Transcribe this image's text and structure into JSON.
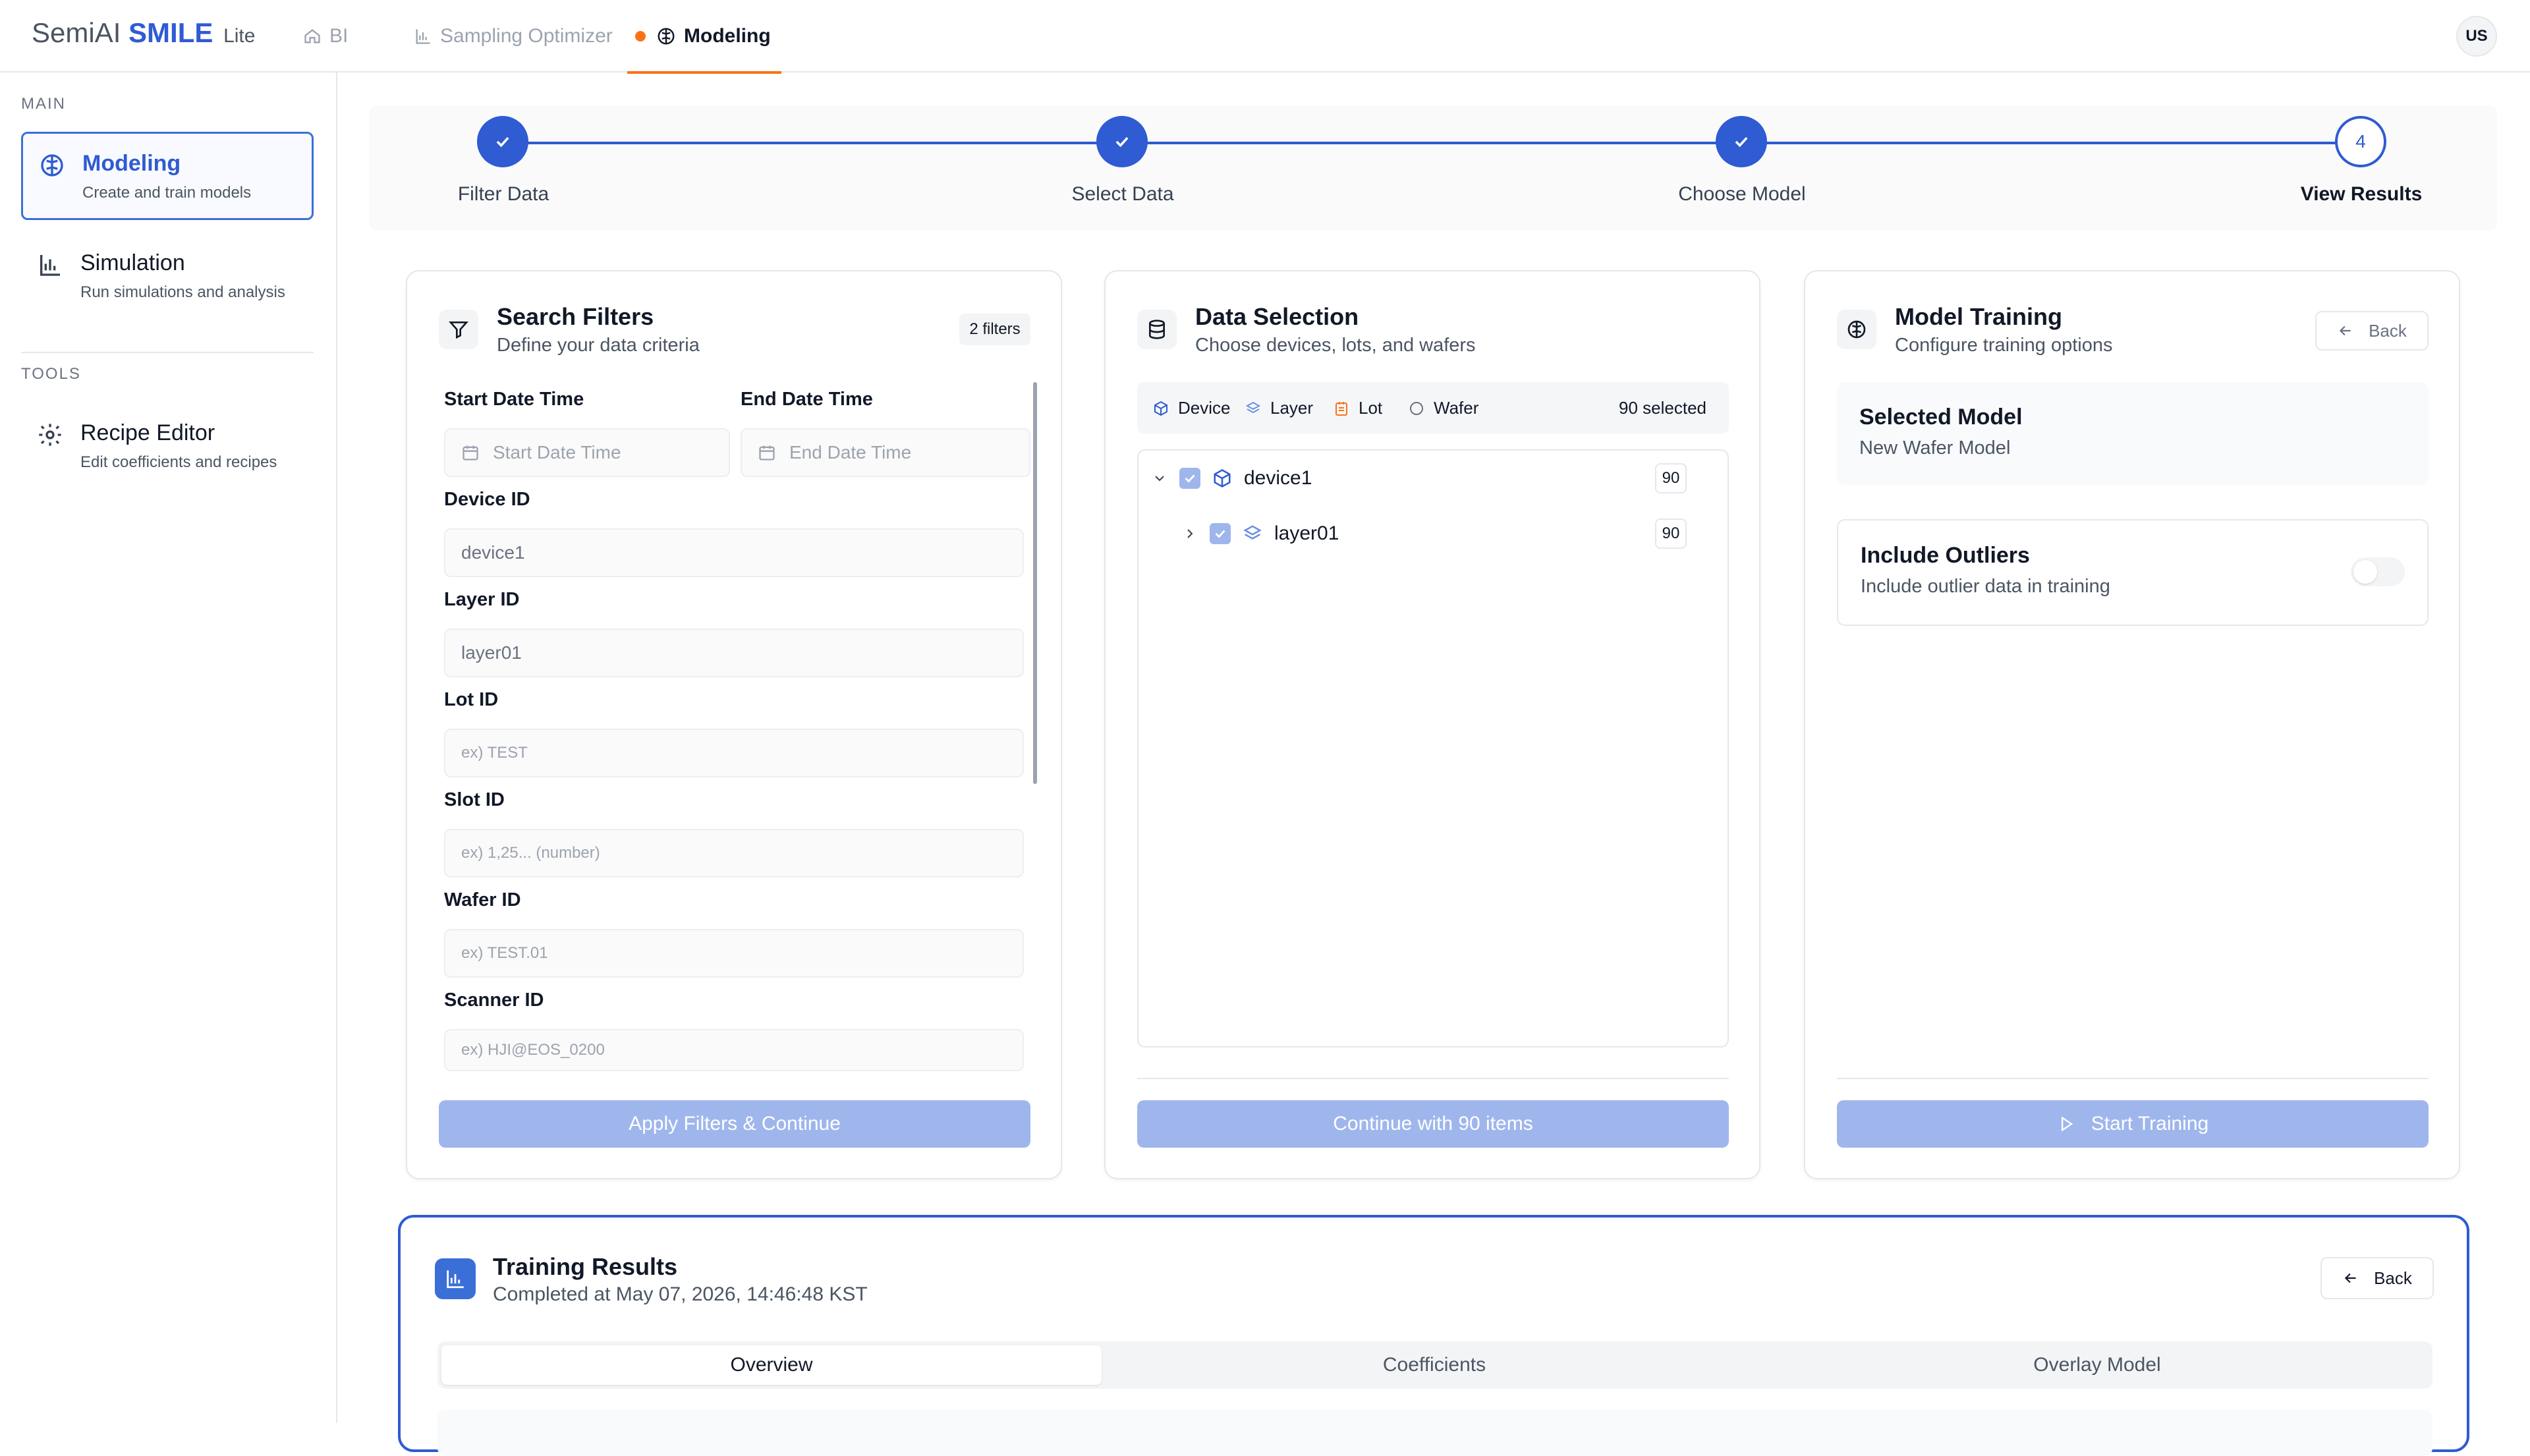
{
  "header": {
    "brand_prefix": "SemiAI",
    "brand_name": "SMILE",
    "brand_suffix": "Lite",
    "nav": [
      {
        "label": "BI",
        "icon": "home-icon"
      },
      {
        "label": "Sampling Optimizer",
        "icon": "bar-chart-icon"
      },
      {
        "label": "Modeling",
        "icon": "brain-icon",
        "active": true
      }
    ],
    "user_initials": "US"
  },
  "sidebar": {
    "main_label": "MAIN",
    "tools_label": "TOOLS",
    "items": [
      {
        "title": "Modeling",
        "subtitle": "Create and train models",
        "icon": "brain-icon",
        "active": true
      },
      {
        "title": "Simulation",
        "subtitle": "Run simulations and analysis",
        "icon": "bar-chart-icon"
      },
      {
        "title": "Recipe Editor",
        "subtitle": "Edit coefficients and recipes",
        "icon": "gear-icon"
      }
    ]
  },
  "stepper": {
    "steps": [
      {
        "label": "Filter Data",
        "state": "done"
      },
      {
        "label": "Select Data",
        "state": "done"
      },
      {
        "label": "Choose Model",
        "state": "done"
      },
      {
        "label": "View Results",
        "state": "current",
        "number": "4"
      }
    ]
  },
  "filters": {
    "title": "Search Filters",
    "subtitle": "Define your data criteria",
    "badge": "2 filters",
    "start_label": "Start Date Time",
    "start_placeholder": "Start Date Time",
    "end_label": "End Date Time",
    "end_placeholder": "End Date Time",
    "fields": [
      {
        "label": "Device ID",
        "value": "device1",
        "placeholder": ""
      },
      {
        "label": "Layer ID",
        "value": "layer01",
        "placeholder": ""
      },
      {
        "label": "Lot ID",
        "value": "",
        "placeholder": "ex) TEST"
      },
      {
        "label": "Slot ID",
        "value": "",
        "placeholder": "ex) 1,25... (number)"
      },
      {
        "label": "Wafer ID",
        "value": "",
        "placeholder": "ex) TEST.01"
      },
      {
        "label": "Scanner ID",
        "value": "",
        "placeholder": "ex) HJI@EOS_0200"
      }
    ],
    "button": "Apply Filters & Continue"
  },
  "selection": {
    "title": "Data Selection",
    "subtitle": "Choose devices, lots, and wafers",
    "legend": [
      "Device",
      "Layer",
      "Lot",
      "Wafer"
    ],
    "selected_text": "90 selected",
    "tree": [
      {
        "label": "device1",
        "count": "90",
        "level": 0,
        "expanded": true
      },
      {
        "label": "layer01",
        "count": "90",
        "level": 1,
        "expanded": false
      }
    ],
    "button": "Continue with 90 items"
  },
  "training": {
    "title": "Model Training",
    "subtitle": "Configure training options",
    "back_label": "Back",
    "selected_model_label": "Selected Model",
    "selected_model_value": "New Wafer Model",
    "outliers_label": "Include Outliers",
    "outliers_desc": "Include outlier data in training",
    "outliers_enabled": false,
    "button": "Start Training"
  },
  "results": {
    "title": "Training Results",
    "completed": "Completed at May 07, 2026, 14:46:48 KST",
    "back_label": "Back",
    "tabs": [
      "Overview",
      "Coefficients",
      "Overlay Model"
    ],
    "active_tab": "Overview"
  },
  "colors": {
    "primary": "#2f5bd3",
    "primary_disabled": "#9fb6ec",
    "accent": "#f97316"
  }
}
